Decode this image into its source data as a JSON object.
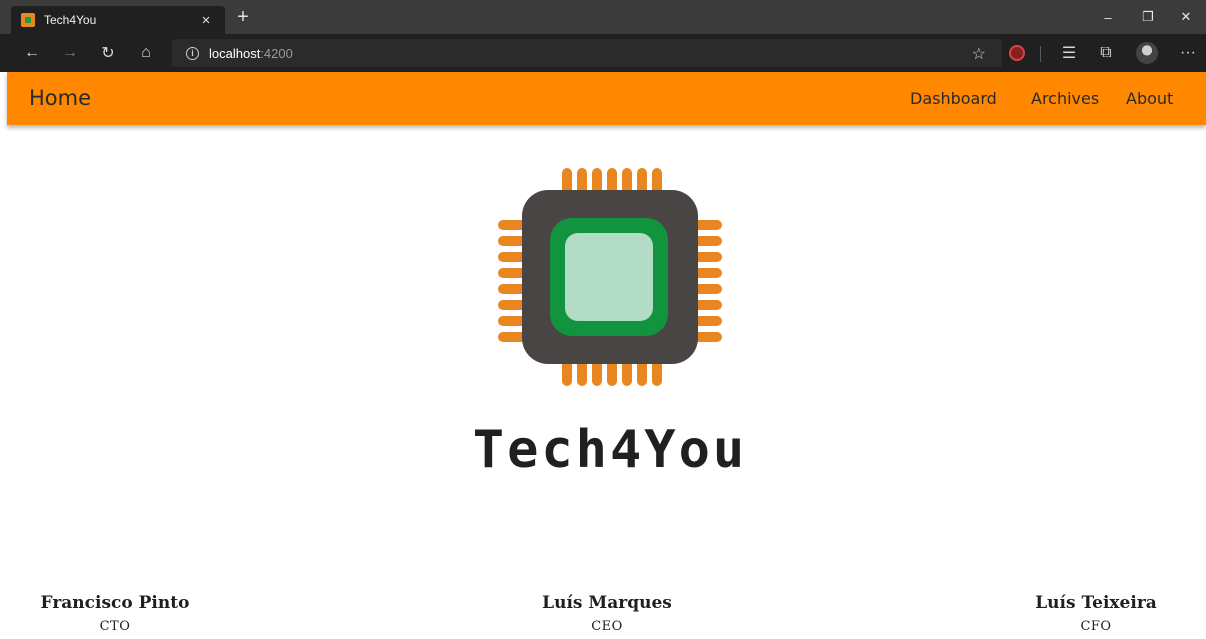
{
  "browser": {
    "tab_title": "Tech4You",
    "tab_close": "×",
    "new_tab": "+",
    "url_host": "localhost",
    "url_port": ":4200",
    "window_controls": [
      "–",
      "❐",
      "✕"
    ],
    "more_label": "···"
  },
  "nav": {
    "brand": "Home",
    "links": [
      "Dashboard",
      "Archives",
      "About"
    ],
    "bar_color": "#ff8800"
  },
  "logo": {
    "wordmark": "Tech4You",
    "colors": {
      "pins": "#e8861f",
      "body": "#4a4545",
      "frame": "#12943f",
      "core": "#b3dcc7"
    }
  },
  "team": [
    {
      "name": "Francisco Pinto",
      "role": "CTO"
    },
    {
      "name": "Luís Marques",
      "role": "CEO"
    },
    {
      "name": "Luís Teixeira",
      "role": "CFO"
    }
  ]
}
